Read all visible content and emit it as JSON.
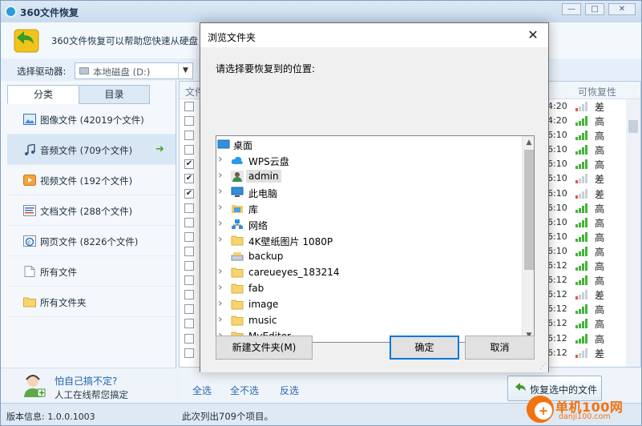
{
  "app": {
    "title": "360文件恢复",
    "header_text": "360文件恢复可以帮助您快速从硬盘",
    "minimize": "—",
    "maximize": "□",
    "close": "✕"
  },
  "drive": {
    "label": "选择驱动器:",
    "value": "本地磁盘 (D:)"
  },
  "left": {
    "tabs": [
      "分类",
      "目录"
    ],
    "categories": [
      {
        "label": "图像文件 (42019个文件)",
        "icon": "image-file-icon"
      },
      {
        "label": "音频文件 (709个文件)",
        "icon": "audio-file-icon"
      },
      {
        "label": "视频文件 (192个文件)",
        "icon": "video-file-icon"
      },
      {
        "label": "文档文件 (288个文件)",
        "icon": "document-file-icon"
      },
      {
        "label": "网页文件 (8226个文件)",
        "icon": "web-file-icon"
      },
      {
        "label": "所有文件",
        "icon": "all-files-icon"
      },
      {
        "label": "所有文件夹",
        "icon": "folder-icon"
      }
    ],
    "help_question": "怕自己搞不定?",
    "help_sub": "人工在线帮您搞定"
  },
  "table": {
    "col_name": "文件",
    "col_recover": "可恢复性",
    "rows": [
      {
        "time": "4:20",
        "rec": "差",
        "checked": false,
        "level": 1
      },
      {
        "time": "4:20",
        "rec": "高",
        "checked": false,
        "level": 4
      },
      {
        "time": "6:10",
        "rec": "高",
        "checked": false,
        "level": 4
      },
      {
        "time": "6:10",
        "rec": "高",
        "checked": false,
        "level": 4
      },
      {
        "time": "6:10",
        "rec": "高",
        "checked": true,
        "level": 4
      },
      {
        "time": "6:10",
        "rec": "差",
        "checked": true,
        "level": 1
      },
      {
        "time": "6:10",
        "rec": "差",
        "checked": true,
        "level": 1
      },
      {
        "time": "6:10",
        "rec": "高",
        "checked": false,
        "level": 4
      },
      {
        "time": "6:10",
        "rec": "高",
        "checked": false,
        "level": 4
      },
      {
        "time": "6:10",
        "rec": "高",
        "checked": false,
        "level": 4
      },
      {
        "time": "6:10",
        "rec": "高",
        "checked": false,
        "level": 4
      },
      {
        "time": "6:12",
        "rec": "高",
        "checked": false,
        "level": 4
      },
      {
        "time": "6:12",
        "rec": "高",
        "checked": false,
        "level": 4
      },
      {
        "time": "6:12",
        "rec": "差",
        "checked": false,
        "level": 1
      },
      {
        "time": "6:12",
        "rec": "高",
        "checked": false,
        "level": 4
      },
      {
        "time": "6:12",
        "rec": "高",
        "checked": false,
        "level": 4
      },
      {
        "time": "6:12",
        "rec": "高",
        "checked": false,
        "level": 4
      },
      {
        "time": "6:12",
        "rec": "差",
        "checked": false,
        "level": 1
      }
    ]
  },
  "actions": {
    "select_all": "全选",
    "select_none": "全不选",
    "invert": "反选",
    "recover": "恢复选中的文件"
  },
  "status": {
    "version": "版本信息: 1.0.0.1003",
    "count": "此次列出709个项目。"
  },
  "watermark": {
    "text": "单机100网",
    "url": "danji100.com"
  },
  "dialog": {
    "title": "浏览文件夹",
    "prompt": "请选择要恢复到的位置:",
    "nodes": [
      {
        "label": "桌面",
        "icon": "desktop-icon",
        "expand": false,
        "level": 0
      },
      {
        "label": "WPS云盘",
        "icon": "cloud-icon",
        "expand": true,
        "level": 1
      },
      {
        "label": "admin",
        "icon": "user-icon",
        "expand": true,
        "level": 1,
        "highlight": true
      },
      {
        "label": "此电脑",
        "icon": "computer-icon",
        "expand": true,
        "level": 1
      },
      {
        "label": "库",
        "icon": "library-icon",
        "expand": true,
        "level": 1
      },
      {
        "label": "网络",
        "icon": "network-icon",
        "expand": true,
        "level": 1
      },
      {
        "label": "4K壁纸图片 1080P",
        "icon": "folder-icon",
        "expand": true,
        "level": 1
      },
      {
        "label": "backup",
        "icon": "drive-folder-icon",
        "expand": false,
        "level": 1
      },
      {
        "label": "careueyes_183214",
        "icon": "folder-icon",
        "expand": true,
        "level": 1
      },
      {
        "label": "fab",
        "icon": "folder-icon",
        "expand": true,
        "level": 1
      },
      {
        "label": "image",
        "icon": "folder-icon",
        "expand": true,
        "level": 1
      },
      {
        "label": "music",
        "icon": "folder-icon",
        "expand": true,
        "level": 1
      },
      {
        "label": "MyEditor",
        "icon": "folder-icon",
        "expand": true,
        "level": 1
      }
    ],
    "new_folder": "新建文件夹(M)",
    "ok": "确定",
    "cancel": "取消",
    "close": "✕"
  }
}
